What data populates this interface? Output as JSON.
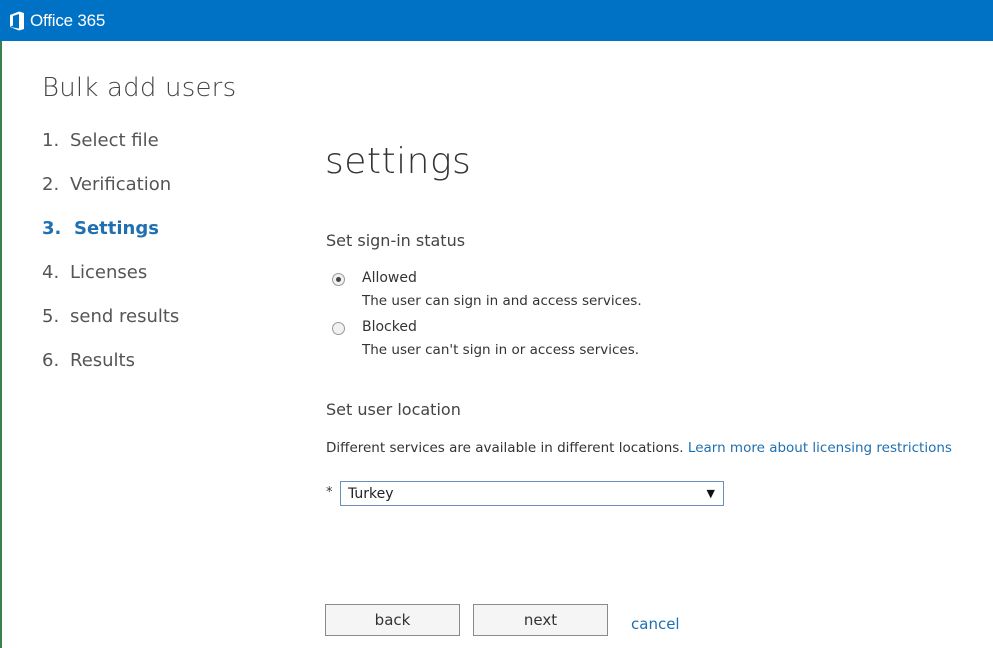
{
  "header": {
    "brand": "Office 365",
    "background": "#0072c6"
  },
  "page": {
    "title": "Bulk add users"
  },
  "steps": [
    {
      "num": "1.",
      "label": "Select file",
      "active": false
    },
    {
      "num": "2.",
      "label": "Verification",
      "active": false
    },
    {
      "num": "3.",
      "label": "Settings",
      "active": true
    },
    {
      "num": "4.",
      "label": "Licenses",
      "active": false
    },
    {
      "num": "5.",
      "label": "send results",
      "active": false
    },
    {
      "num": "6.",
      "label": "Results",
      "active": false
    }
  ],
  "main": {
    "title": "settings",
    "signin": {
      "heading": "Set sign-in status",
      "options": [
        {
          "label": "Allowed",
          "desc": "The user can sign in and access services.",
          "checked": true
        },
        {
          "label": "Blocked",
          "desc": "The user can't sign in or access services.",
          "checked": false
        }
      ]
    },
    "location": {
      "heading": "Set user location",
      "desc": "Different services are available in different locations.",
      "link": "Learn more about licensing restrictions",
      "required_mark": "*",
      "selected": "Turkey",
      "arrow": "▼"
    }
  },
  "footer": {
    "back": "back",
    "next": "next",
    "cancel": "cancel"
  },
  "colors": {
    "accent": "#1f6fb1",
    "header": "#0072c6"
  }
}
